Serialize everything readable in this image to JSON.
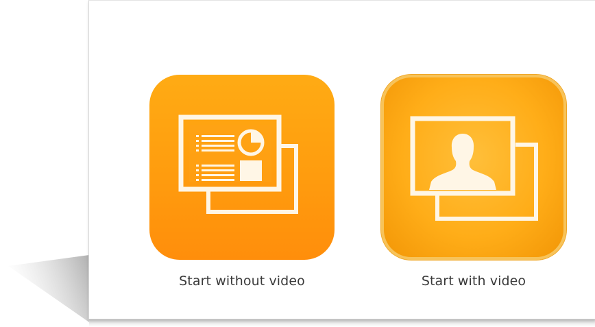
{
  "options": [
    {
      "label": "Start without video",
      "icon": "presentation-screen-icon"
    },
    {
      "label": "Start with video",
      "icon": "video-person-icon"
    }
  ],
  "colors": {
    "tile_top": "#ffab14",
    "tile_bottom": "#ff8e0b",
    "glyph": "#fff6e6",
    "caption": "#3a3a3a"
  }
}
